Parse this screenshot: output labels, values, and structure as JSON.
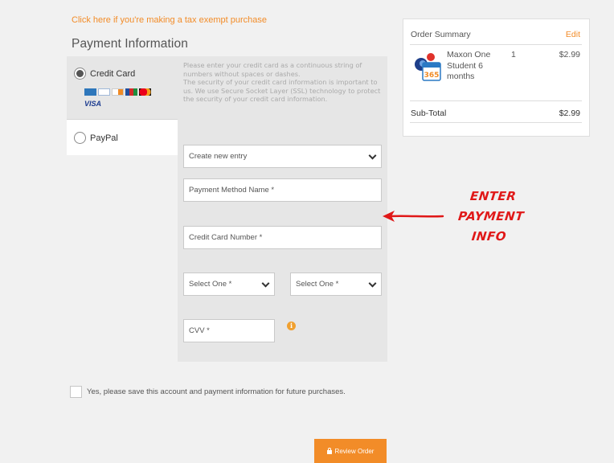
{
  "tax_exempt_link": "Click here if you're making a tax exempt purchase",
  "payment_title": "Payment Information",
  "methods": {
    "credit_card": {
      "label": "Credit Card",
      "selected": true,
      "card_icons": [
        "amex-icon",
        "diners-icon",
        "discover-icon",
        "jcb-icon",
        "mastercard-icon",
        "visa-icon"
      ],
      "visa_text": "VISA"
    },
    "paypal": {
      "label": "PayPal",
      "selected": false
    }
  },
  "instructions": "Please enter your credit card as a continuous string of numbers without spaces or dashes.\nThe security of your credit card information is important to us. We use Secure Socket Layer (SSL) technology to protect the security of your credit card information.",
  "form": {
    "entry_select": "Create new entry",
    "method_name_placeholder": "Payment Method Name *",
    "card_number_placeholder": "Credit Card Number *",
    "month_select": "Select One *",
    "year_select": "Select One *",
    "cvv_placeholder": "CVV *",
    "info_icon": "info-icon"
  },
  "save_info_label": "Yes, please save this account and payment information for future purchases.",
  "review_button": "Review Order",
  "annotation": {
    "line1": "ENTER",
    "line2": "PAYMENT",
    "line3": "INFO"
  },
  "summary": {
    "title": "Order Summary",
    "edit_label": "Edit",
    "product": {
      "name": "Maxon One Student 6 months",
      "qty": "1",
      "price": "$2.99",
      "icon_label": "365"
    },
    "subtotal_label": "Sub-Total",
    "subtotal_value": "$2.99"
  },
  "colors": {
    "accent": "#f28c28",
    "annotation": "#e01818",
    "panel": "#e6e6e6",
    "background": "#f1f1f1"
  }
}
